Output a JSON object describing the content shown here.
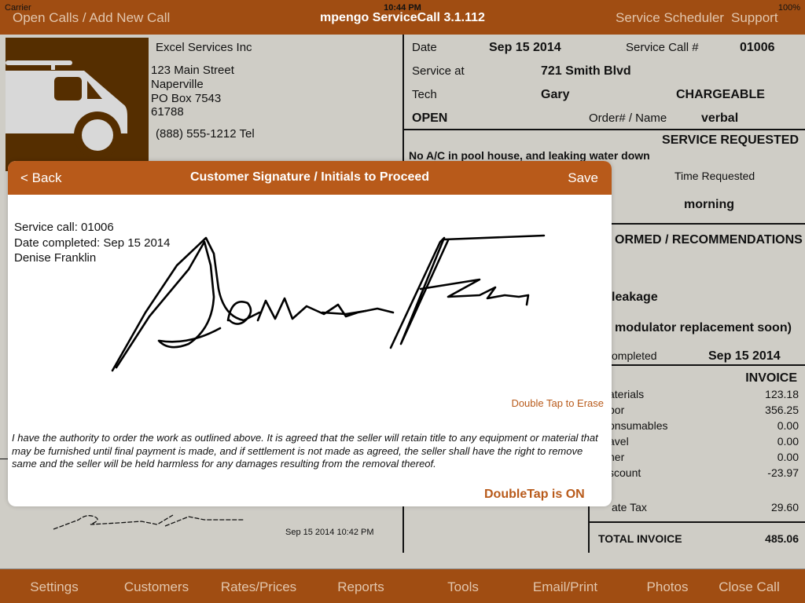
{
  "status_bar": {
    "carrier": "Carrier",
    "time": "10:44 PM",
    "battery": "100%"
  },
  "nav": {
    "left": "Open Calls / Add New Call",
    "title": "mpengo ServiceCall 3.1.112",
    "scheduler": "Service Scheduler",
    "support": "Support"
  },
  "company": {
    "name": "Excel Services Inc",
    "address": [
      "123 Main Street",
      "Naperville",
      "PO Box 7543",
      "61788"
    ],
    "phone": "(888) 555-1212 Tel"
  },
  "call": {
    "date_label": "Date",
    "date": "Sep 15 2014",
    "call_no_label": "Service Call #",
    "call_no": "01006",
    "service_at_label": "Service at",
    "service_at": "721 Smith Blvd",
    "tech_label": "Tech",
    "tech": "Gary",
    "billing": "CHARGEABLE",
    "status": "OPEN",
    "order_label": "Order# / Name",
    "order": "verbal"
  },
  "service_requested": {
    "heading": "SERVICE REQUESTED",
    "description": "No A/C in pool house, and leaking water down",
    "time_label": "Time Requested",
    "time": "morning"
  },
  "performed": {
    "heading": "ORMED / RECOMMENDATIONS",
    "line1": "leakage",
    "line2": "modulator replacement soon)",
    "completed_label": "ompleted",
    "completed": "Sep 15 2014"
  },
  "invoice": {
    "heading": "INVOICE",
    "rows": [
      {
        "label": "aterials",
        "value": "123.18"
      },
      {
        "label": "bor",
        "value": "356.25"
      },
      {
        "label": "onsumables",
        "value": "0.00"
      },
      {
        "label": "avel",
        "value": "0.00"
      },
      {
        "label": "her",
        "value": "0.00"
      },
      {
        "label": "scount",
        "value": "-23.97"
      }
    ],
    "tax_label": "ate Tax",
    "tax": "29.60",
    "total_label": "TOTAL INVOICE",
    "total": "485.06"
  },
  "bg_signature": {
    "timestamp": "Sep 15 2014 10:42 PM"
  },
  "modal": {
    "back": "< Back",
    "title": "Customer Signature / Initials to Proceed",
    "save": "Save",
    "call": "Service call: 01006",
    "completed": "Date completed: Sep 15 2014",
    "customer": "Denise Franklin",
    "erase_hint": "Double Tap to Erase",
    "legal": "I have the authority to order the work as outlined above.  It is agreed that the seller will retain title to any equipment or material that may be furnished until final payment is made, and if settlement is not made as agreed, the seller shall have the right to remove same and the seller will be held harmless for any damages resulting from the removal thereof.",
    "doubletap": "DoubleTap is ON"
  },
  "tabs": [
    "Settings",
    "Customers",
    "Rates/Prices",
    "Reports",
    "Tools",
    "Email/Print",
    "Photos",
    "Close Call"
  ],
  "colors": {
    "bar": "#a04d12",
    "modal_header": "#b85a1a",
    "accent_text": "#b85a1a",
    "background": "#cfcdc6"
  }
}
